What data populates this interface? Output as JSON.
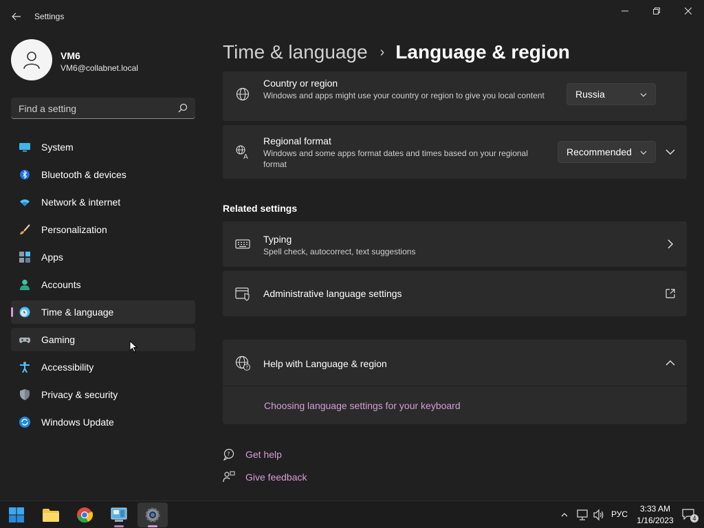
{
  "app": {
    "title": "Settings"
  },
  "user": {
    "name": "VM6",
    "email": "VM6@collabnet.local"
  },
  "search": {
    "placeholder": "Find a setting"
  },
  "sidebar": {
    "items": [
      {
        "label": "System",
        "icon": "monitor-icon"
      },
      {
        "label": "Bluetooth & devices",
        "icon": "bluetooth-icon"
      },
      {
        "label": "Network & internet",
        "icon": "wifi-icon"
      },
      {
        "label": "Personalization",
        "icon": "brush-icon"
      },
      {
        "label": "Apps",
        "icon": "apps-icon"
      },
      {
        "label": "Accounts",
        "icon": "account-icon"
      },
      {
        "label": "Time & language",
        "icon": "globe-clock-icon",
        "selected": true
      },
      {
        "label": "Gaming",
        "icon": "gamepad-icon"
      },
      {
        "label": "Accessibility",
        "icon": "accessibility-icon"
      },
      {
        "label": "Privacy & security",
        "icon": "shield-icon"
      },
      {
        "label": "Windows Update",
        "icon": "update-icon"
      }
    ]
  },
  "header": {
    "parent": "Time & language",
    "separator": "›",
    "current": "Language & region"
  },
  "region": {
    "country": {
      "title": "Country or region",
      "desc": "Windows and apps might use your country or region to give you local content",
      "value": "Russia"
    },
    "format": {
      "title": "Regional format",
      "desc": "Windows and some apps format dates and times based on your regional format",
      "value": "Recommended"
    }
  },
  "related": {
    "heading": "Related settings",
    "typing": {
      "title": "Typing",
      "desc": "Spell check, autocorrect, text suggestions"
    },
    "admin": {
      "title": "Administrative language settings"
    }
  },
  "help": {
    "title": "Help with Language & region",
    "link": "Choosing language settings for your keyboard"
  },
  "footer": {
    "get_help": "Get help",
    "give_feedback": "Give feedback"
  },
  "taskbar": {
    "language": "РУС",
    "time": "3:33 AM",
    "date": "1/16/2023",
    "notifications": "4"
  },
  "colors": {
    "accent": "#d69cd9",
    "background": "#202020",
    "card": "#2b2b2b"
  }
}
